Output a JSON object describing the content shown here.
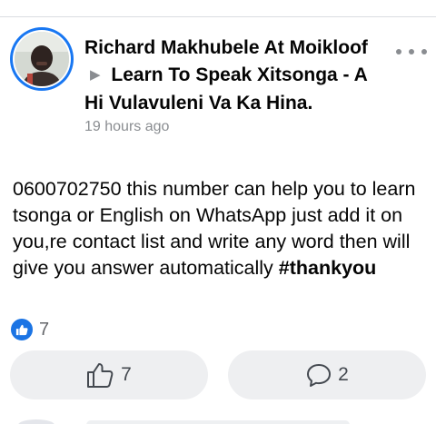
{
  "post": {
    "author": "Richard Makhubele At Moikloof",
    "group": "Learn To Speak Xitsonga - A Hi Vulavuleni Va Ka Hina.",
    "timestamp": "19 hours ago",
    "body": "0600702750 this number can help you to learn tsonga or English on WhatsApp just add it on you,re contact list and write any word then will give you answer automatically ",
    "hashtag": "#thankyou",
    "reactions_count": "7"
  },
  "actions": {
    "like_count": "7",
    "comment_count": "2"
  },
  "colors": {
    "accent": "#1877f2",
    "muted_text": "#8a8d91",
    "button_bg": "#eeeff1"
  },
  "icons": [
    "avatar",
    "arrow-right-icon",
    "more-options-icon",
    "like-badge-icon",
    "thumbs-up-icon",
    "comment-icon"
  ]
}
